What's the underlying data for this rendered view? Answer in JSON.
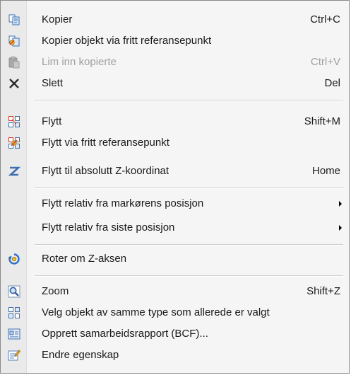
{
  "menu": {
    "items": [
      {
        "label": "Kopier",
        "shortcut": "Ctrl+C",
        "icon": "copy-icon",
        "enabled": true
      },
      {
        "label": "Kopier objekt via fritt referansepunkt",
        "shortcut": "",
        "icon": "copy-reference-icon",
        "enabled": true
      },
      {
        "label": "Lim inn kopierte",
        "shortcut": "Ctrl+V",
        "icon": "paste-icon",
        "enabled": false
      },
      {
        "label": "Slett",
        "shortcut": "Del",
        "icon": "delete-icon",
        "enabled": true
      },
      {
        "label": "Flytt",
        "shortcut": "Shift+M",
        "icon": "move-icon",
        "enabled": true
      },
      {
        "label": "Flytt via fritt referansepunkt",
        "shortcut": "",
        "icon": "move-reference-icon",
        "enabled": true
      },
      {
        "label": "Flytt til absolutt Z-koordinat",
        "shortcut": "Home",
        "icon": "z-coordinate-icon",
        "enabled": true
      },
      {
        "label": "Flytt relativ fra markørens posisjon",
        "shortcut": "",
        "icon": "",
        "enabled": true,
        "submenu": true
      },
      {
        "label": "Flytt relativ fra siste posisjon",
        "shortcut": "",
        "icon": "",
        "enabled": true,
        "submenu": true
      },
      {
        "label": "Roter om Z-aksen",
        "shortcut": "",
        "icon": "rotate-icon",
        "enabled": true
      },
      {
        "label": "Zoom",
        "shortcut": "Shift+Z",
        "icon": "zoom-icon",
        "enabled": true
      },
      {
        "label": "Velg objekt av samme type som allerede er valgt",
        "shortcut": "",
        "icon": "select-same-type-icon",
        "enabled": true
      },
      {
        "label": "Opprett samarbeidsrapport (BCF)...",
        "shortcut": "",
        "icon": "bcf-report-icon",
        "enabled": true
      },
      {
        "label": "Endre egenskap",
        "shortcut": "",
        "icon": "properties-icon",
        "enabled": true
      }
    ]
  },
  "colors": {
    "menu_background": "#f5f5f5",
    "icon_strip": "#eaeaea",
    "disabled_text": "#a0a0a0",
    "accent_blue": "#2f6fc6",
    "accent_red": "#d23a2a"
  }
}
